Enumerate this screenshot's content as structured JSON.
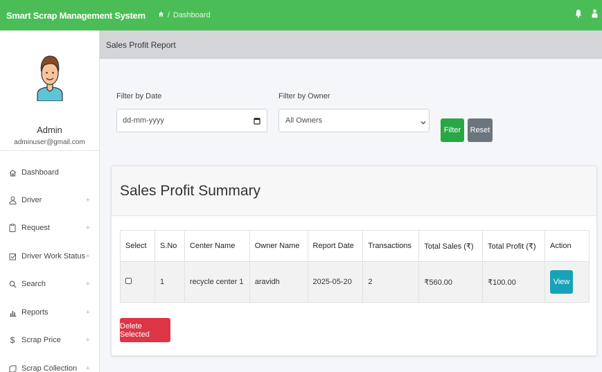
{
  "header": {
    "brand": "Smart Scrap Management System",
    "breadcrumb_sep": "/",
    "breadcrumb_current": "Dashboard",
    "accent_color": "#4bbd57"
  },
  "user": {
    "name": "Admin",
    "email": "adminuser@gmail.com"
  },
  "sidebar": {
    "items": [
      {
        "label": "Dashboard",
        "icon": "home-icon",
        "expandable": false
      },
      {
        "label": "Driver",
        "icon": "user-icon",
        "expandable": true
      },
      {
        "label": "Request",
        "icon": "clipboard-icon",
        "expandable": true
      },
      {
        "label": "Driver Work Status",
        "icon": "checkbox-icon",
        "expandable": true
      },
      {
        "label": "Search",
        "icon": "search-icon",
        "expandable": true
      },
      {
        "label": "Reports",
        "icon": "bar-chart-icon",
        "expandable": true
      },
      {
        "label": "Scrap Price",
        "icon": "dollar-icon",
        "expandable": true
      },
      {
        "label": "Scrap Collection",
        "icon": "collection-icon",
        "expandable": true
      }
    ],
    "expand_glyph": "+"
  },
  "page": {
    "title": "Sales Profit Report"
  },
  "filters": {
    "date_label": "Filter by Date",
    "date_placeholder": "dd-mm-yyyy",
    "owner_label": "Filter by Owner",
    "owner_selected": "All Owners",
    "filter_button": "Filter",
    "reset_button": "Reset"
  },
  "summary": {
    "title": "Sales Profit Summary",
    "columns": [
      "Select",
      "S.No",
      "Center Name",
      "Owner Name",
      "Report Date",
      "Transactions",
      "Total Sales (₹)",
      "Total Profit (₹)",
      "Action"
    ],
    "rows": [
      {
        "sno": "1",
        "center": "recycle center 1",
        "owner": "aravidh",
        "date": "2025-05-20",
        "transactions": "2",
        "sales": "₹560.00",
        "profit": "₹100.00",
        "action": "View"
      }
    ],
    "delete_button": "Delete Selected"
  }
}
